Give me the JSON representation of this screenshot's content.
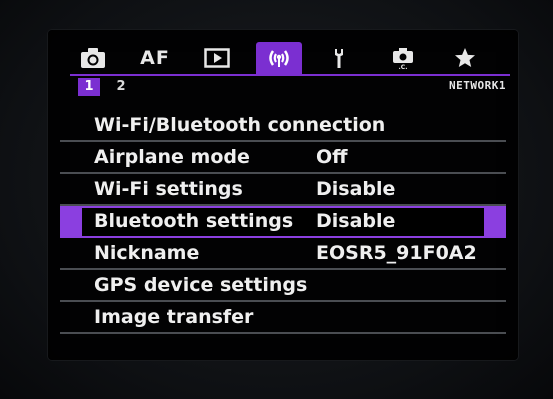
{
  "tabs": [
    {
      "name": "tab-shooting",
      "icon": "camera-icon",
      "active": false
    },
    {
      "name": "tab-af",
      "label": "AF",
      "active": false
    },
    {
      "name": "tab-playback",
      "icon": "playback-icon",
      "active": false
    },
    {
      "name": "tab-network",
      "icon": "wireless-icon",
      "active": true
    },
    {
      "name": "tab-setup",
      "icon": "wrench-icon",
      "active": false
    },
    {
      "name": "tab-custom",
      "icon": "custom-functions-icon",
      "active": false
    },
    {
      "name": "tab-mymenu",
      "icon": "star-icon",
      "active": false
    }
  ],
  "subtabs": [
    {
      "label": "1",
      "active": true
    },
    {
      "label": "2",
      "active": false
    }
  ],
  "page_name": "NETWORK1",
  "accent_color": "#7b2fd1",
  "menu": [
    {
      "label": "Wi-Fi/Bluetooth connection",
      "value": ""
    },
    {
      "label": "Airplane mode",
      "value": "Off"
    },
    {
      "label": "Wi-Fi settings",
      "value": "Disable"
    },
    {
      "label": "Bluetooth settings",
      "value": "Disable",
      "selected": true
    },
    {
      "label": "Nickname",
      "value": "EOSR5_91F0A2"
    },
    {
      "label": "GPS device settings",
      "value": ""
    },
    {
      "label": "Image transfer",
      "value": ""
    }
  ]
}
